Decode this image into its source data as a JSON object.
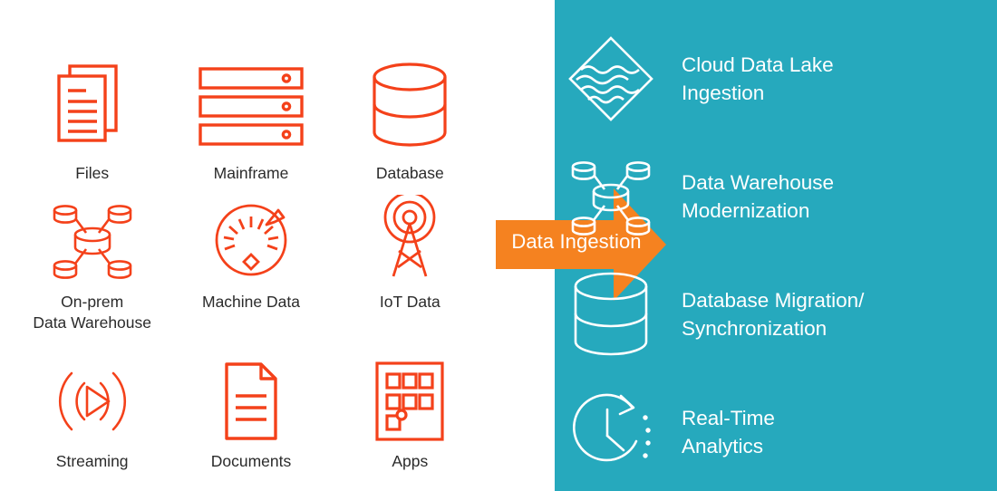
{
  "colors": {
    "source_icon": "#f4411a",
    "panel_background": "#26a9bd",
    "arrow": "#f58220",
    "arrow_text": "#ffffff",
    "source_label_text": "#2b2b2b",
    "outcome_text": "#ffffff",
    "page_background": "#ffffff"
  },
  "sources": {
    "items": [
      {
        "id": "files",
        "label": "Files",
        "icon": "files-icon"
      },
      {
        "id": "mainframe",
        "label": "Mainframe",
        "icon": "mainframe-icon"
      },
      {
        "id": "database",
        "label": "Database",
        "icon": "database-icon"
      },
      {
        "id": "on-prem-dw",
        "label": "On-prem\nData Warehouse",
        "icon": "data-warehouse-network-icon"
      },
      {
        "id": "machine-data",
        "label": "Machine Data",
        "icon": "gauge-icon"
      },
      {
        "id": "iot-data",
        "label": "IoT Data",
        "icon": "antenna-tower-icon"
      },
      {
        "id": "streaming",
        "label": "Streaming",
        "icon": "streaming-play-icon"
      },
      {
        "id": "documents",
        "label": "Documents",
        "icon": "document-icon"
      },
      {
        "id": "apps",
        "label": "Apps",
        "icon": "apps-grid-icon"
      }
    ]
  },
  "arrow": {
    "label": "Data Ingestion",
    "direction": "right"
  },
  "outcomes": {
    "items": [
      {
        "id": "cloud-data-lake",
        "label": "Cloud Data Lake\nIngestion",
        "icon": "data-lake-diamond-icon"
      },
      {
        "id": "data-warehouse-mod",
        "label": "Data Warehouse\nModernization",
        "icon": "data-warehouse-network-icon"
      },
      {
        "id": "database-migration",
        "label": "Database Migration/\nSynchronization",
        "icon": "database-cylinder-icon"
      },
      {
        "id": "real-time-analytics",
        "label": "Real-Time\nAnalytics",
        "icon": "clock-arrow-icon"
      }
    ]
  }
}
